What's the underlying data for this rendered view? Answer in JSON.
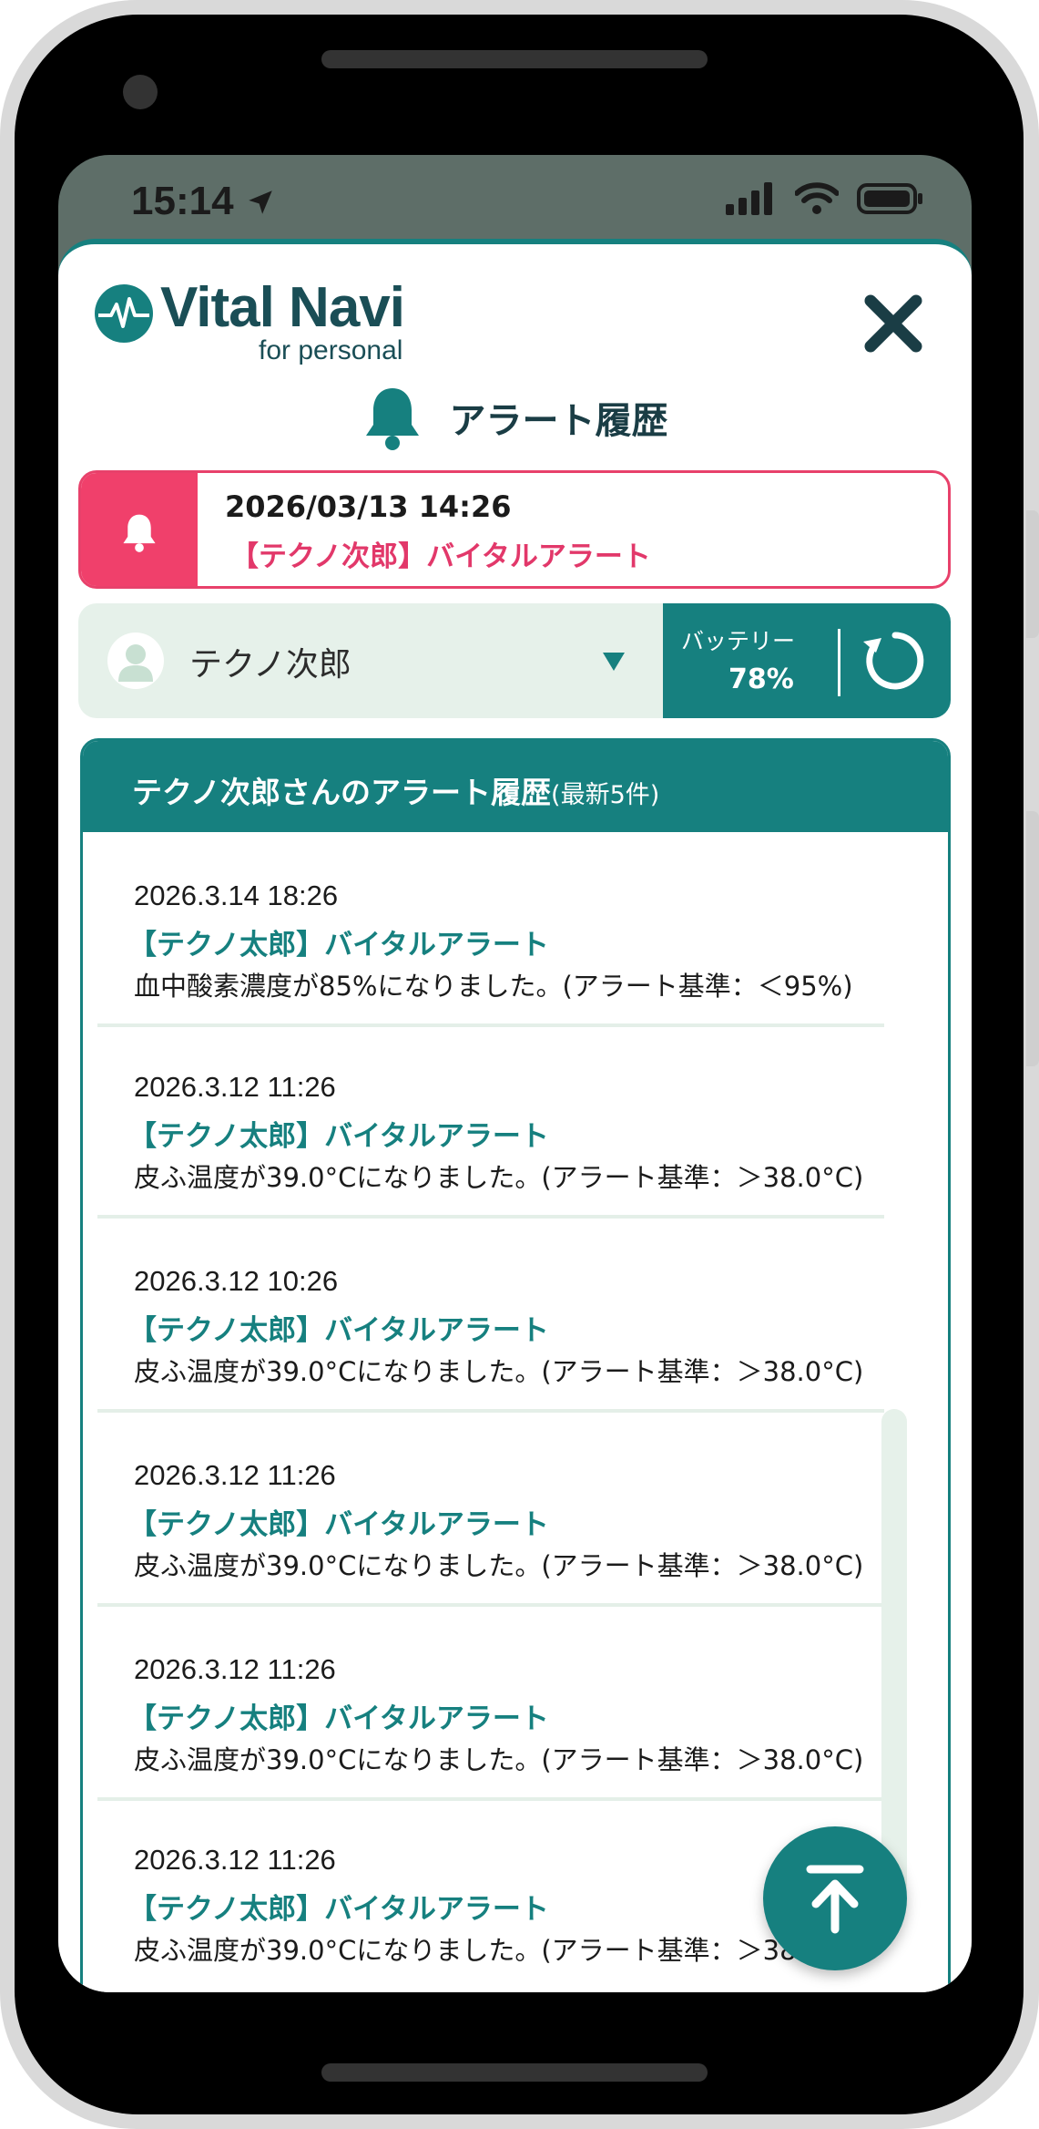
{
  "status_bar": {
    "time": "15:14"
  },
  "app": {
    "logo_name": "Vital Navi",
    "logo_subtitle": "for personal"
  },
  "page": {
    "title": "アラート履歴"
  },
  "latest_alert": {
    "datetime": "2026/03/13 14:26",
    "message": "【テクノ次郎】バイタルアラート"
  },
  "person_selector": {
    "selected": "テクノ次郎",
    "battery_label": "バッテリー",
    "battery_value": "78%"
  },
  "history": {
    "header_main": "テクノ次郎さんのアラート履歴",
    "header_sub": "(最新5件)",
    "items": [
      {
        "date": "2026.3.14 18:26",
        "title": "【テクノ太郎】バイタルアラート",
        "body": "血中酸素濃度が85%になりました。(アラート基準：＜95%)"
      },
      {
        "date": "2026.3.12 11:26",
        "title": "【テクノ太郎】バイタルアラート",
        "body": "皮ふ温度が39.0°Cになりました。(アラート基準：＞38.0°C)"
      },
      {
        "date": "2026.3.12 10:26",
        "title": "【テクノ太郎】バイタルアラート",
        "body": "皮ふ温度が39.0°Cになりました。(アラート基準：＞38.0°C)"
      },
      {
        "date": "2026.3.12 11:26",
        "title": "【テクノ太郎】バイタルアラート",
        "body": "皮ふ温度が39.0°Cになりました。(アラート基準：＞38.0°C)"
      },
      {
        "date": "2026.3.12 11:26",
        "title": "【テクノ太郎】バイタルアラート",
        "body": "皮ふ温度が39.0°Cになりました。(アラート基準：＞38.0°C)"
      },
      {
        "date": "2026.3.12 11:26",
        "title": "【テクノ太郎】バイタルアラート",
        "body": "皮ふ温度が39.0°Cになりました。(アラート基準：＞38.0°C)"
      }
    ]
  },
  "icons": {
    "location": "location-arrow-icon",
    "signal": "cellular-signal-icon",
    "wifi": "wifi-icon",
    "battery": "battery-icon",
    "close": "close-icon",
    "bell": "bell-icon",
    "refresh": "refresh-icon",
    "scroll_top": "arrow-to-top-icon"
  },
  "colors": {
    "primary": "#16807f",
    "alert": "#f0406b",
    "light": "#e6f1ea",
    "navy": "#1a3d45"
  }
}
